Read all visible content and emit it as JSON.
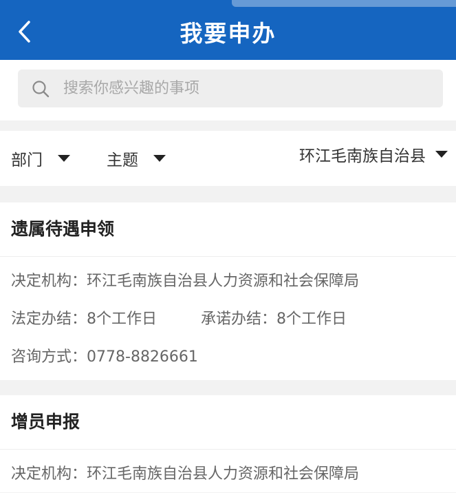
{
  "header": {
    "title": "我要申办"
  },
  "search": {
    "placeholder": "搜索你感兴趣的事项"
  },
  "filters": {
    "department": "部门",
    "topic": "主题",
    "region": "环江毛南族自治县"
  },
  "items": [
    {
      "title": "遗属待遇申领",
      "org_label": "决定机构：",
      "org": "环江毛南族自治县人力资源和社会保障局",
      "legal_label": "法定办结：",
      "legal": "8个工作日",
      "promise_label": "承诺办结：",
      "promise": "8个工作日",
      "contact_label": "咨询方式：",
      "contact": "0778-8826661"
    },
    {
      "title": "增员申报",
      "org_label": "决定机构：",
      "org": "环江毛南族自治县人力资源和社会保障局"
    }
  ],
  "colors": {
    "header_bg": "#1565c0",
    "page_bg": "#f2f2f2"
  },
  "icons": {
    "back": "chevron-left-icon",
    "search": "search-icon",
    "dropdown": "caret-down-icon"
  }
}
